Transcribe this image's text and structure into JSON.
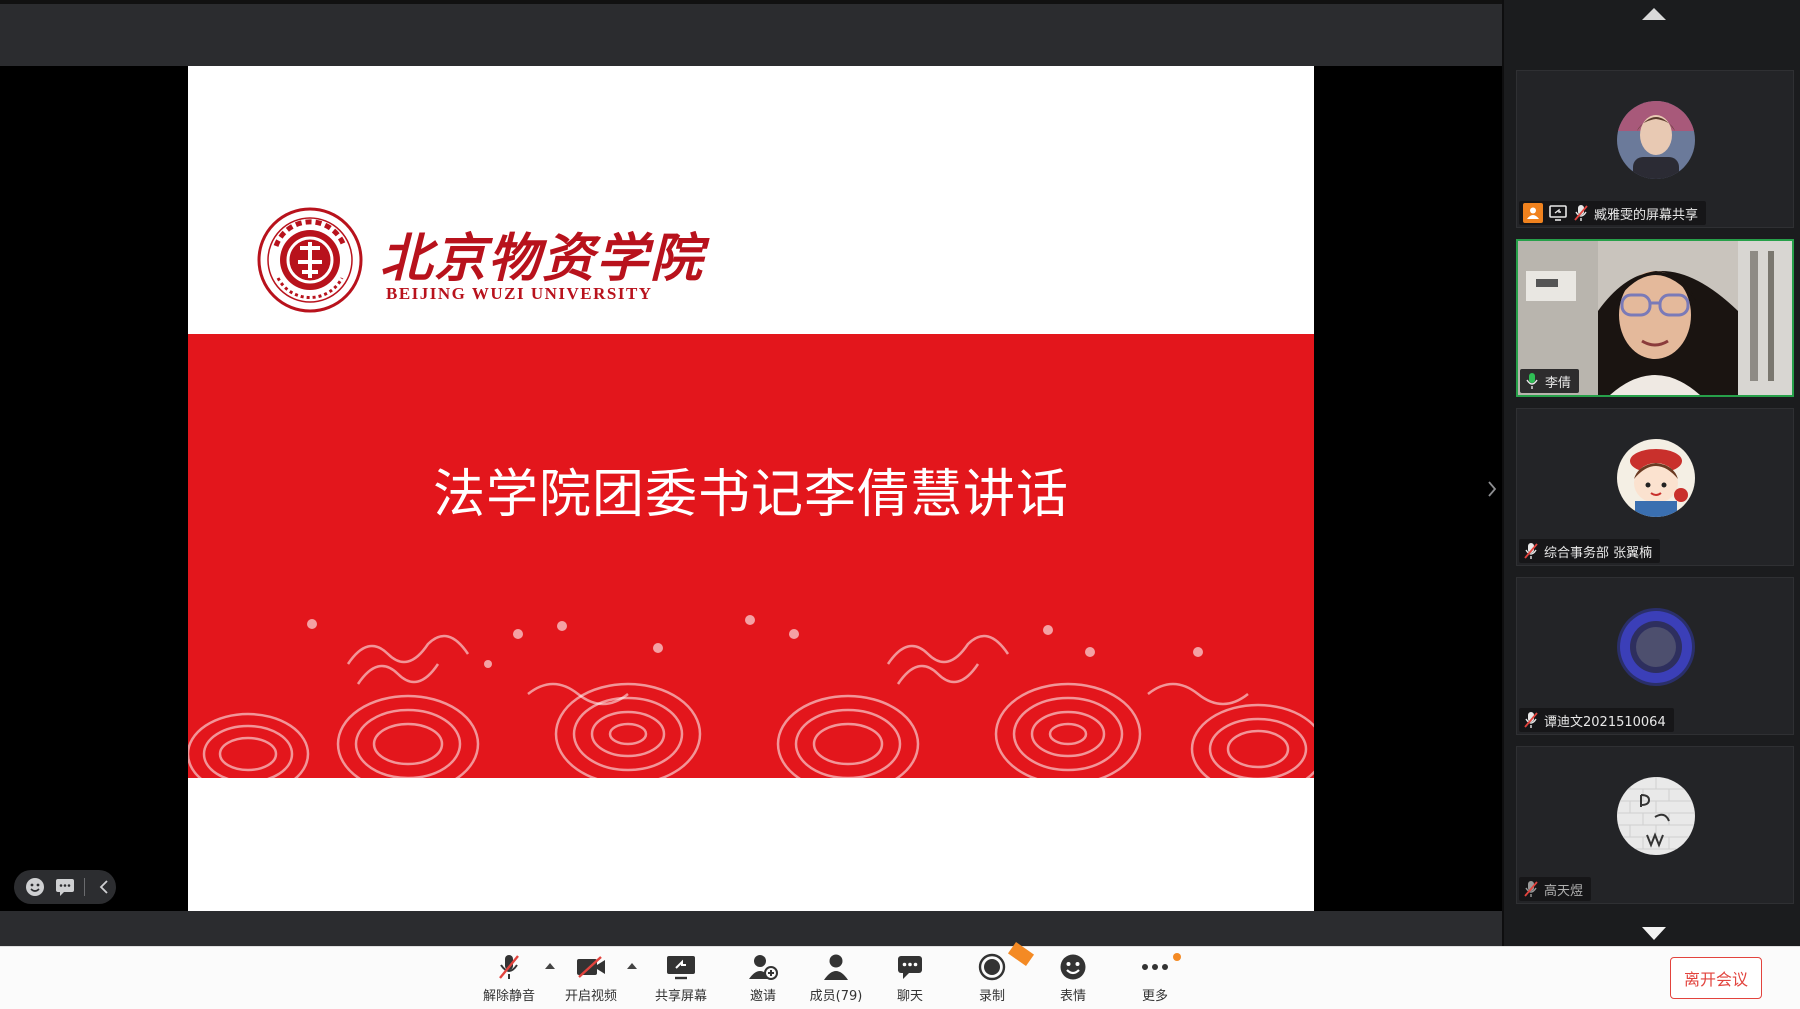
{
  "slide": {
    "logo_cn": "北京物资学院",
    "logo_en": "BEIJING WUZI UNIVERSITY",
    "title": "法学院团委书记李倩慧讲话"
  },
  "participants": [
    {
      "name": "臧雅雯的屏幕共享",
      "avatar": "photo-avatar-icon",
      "host": true,
      "sharing": true,
      "muted": true
    },
    {
      "name": "李倩",
      "avatar": "video-feed",
      "active_speaker": true,
      "muted": false
    },
    {
      "name": "综合事务部 张翼楠",
      "avatar": "cartoon-avatar-icon",
      "muted": true
    },
    {
      "name": "谭迪文2021510064",
      "avatar": "ring-avatar-icon",
      "muted": true
    },
    {
      "name": "高天煜",
      "avatar": "album-avatar-icon",
      "muted": true
    }
  ],
  "toolbar": {
    "unmute": "解除静音",
    "start_video": "开启视频",
    "share_screen": "共享屏幕",
    "invite": "邀请",
    "members": "成员(79)",
    "chat": "聊天",
    "record": "录制",
    "reactions": "表情",
    "more": "更多",
    "leave": "离开会议"
  },
  "colors": {
    "slide_red": "#e3161c",
    "logo_red": "#b8121c",
    "active_border": "#27a04a",
    "leave_red": "#e2433d",
    "badge_orange": "#f48a24",
    "host_orange": "#f0821e"
  }
}
